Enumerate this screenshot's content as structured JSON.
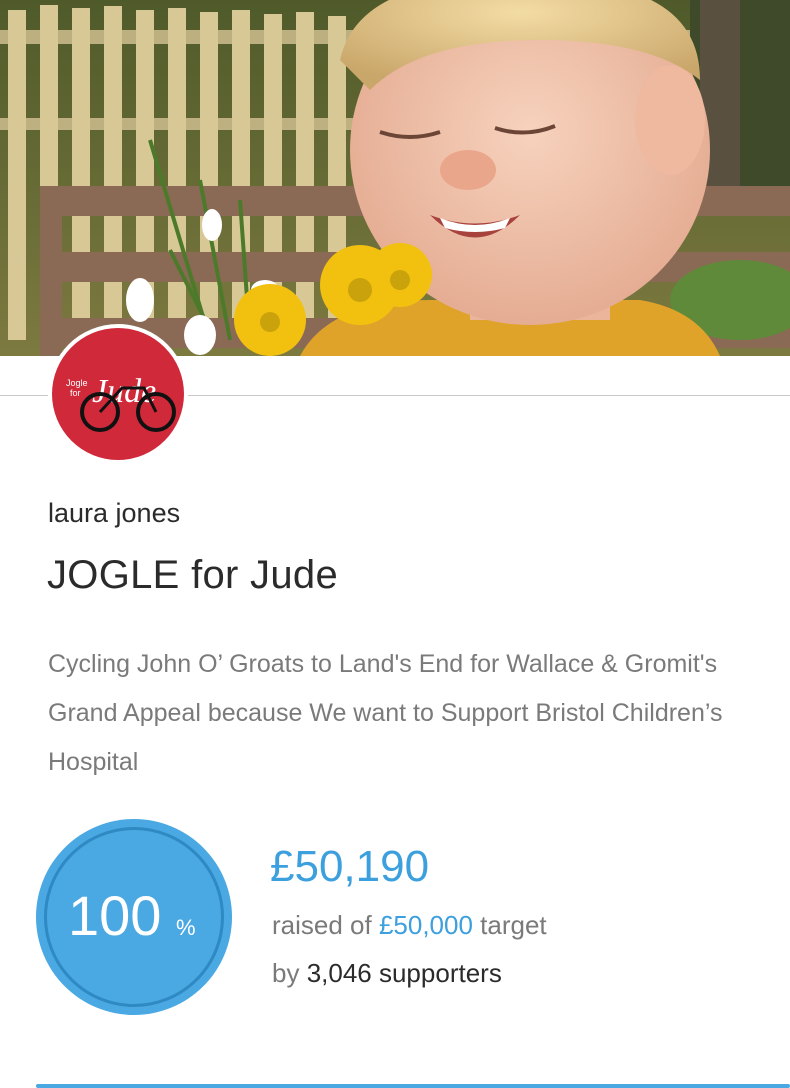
{
  "hero": {
    "image": "child-with-flowers-photo"
  },
  "logo": {
    "icon": "bicycle-icon",
    "small_text_line1": "Jogle",
    "small_text_line2": "for",
    "brand_text": "Jude",
    "color": "#d0293a"
  },
  "page": {
    "owner_name": "laura jones",
    "title": "JOGLE for Jude",
    "description": "Cycling John O’ Groats to Land's End for Wallace & Gromit's Grand Appeal because We want to Support Bristol Children’s Hospital"
  },
  "progress": {
    "percent_value": "100",
    "percent_sign": "%",
    "raised_amount": "£50,190",
    "raised_prefix": "raised of ",
    "target_amount": "£50,000",
    "target_suffix": " target",
    "by_prefix": "by ",
    "supporters_text": "3,046 supporters",
    "accent_color": "#4aa8e2"
  }
}
